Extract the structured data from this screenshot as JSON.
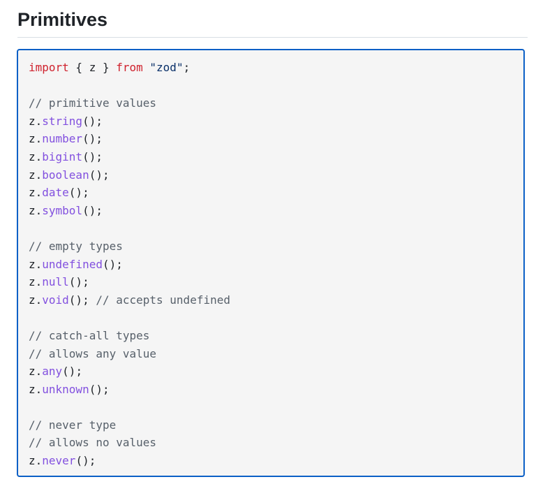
{
  "heading": "Primitives",
  "code_lines": [
    [
      {
        "t": "import",
        "c": "kw"
      },
      {
        "t": " { z } ",
        "c": "pl"
      },
      {
        "t": "from",
        "c": "kw"
      },
      {
        "t": " ",
        "c": "pl"
      },
      {
        "t": "\"zod\"",
        "c": "str"
      },
      {
        "t": ";",
        "c": "pl"
      }
    ],
    [],
    [
      {
        "t": "// primitive values",
        "c": "cm"
      }
    ],
    [
      {
        "t": "z.",
        "c": "pl"
      },
      {
        "t": "string",
        "c": "fn"
      },
      {
        "t": "();",
        "c": "pl"
      }
    ],
    [
      {
        "t": "z.",
        "c": "pl"
      },
      {
        "t": "number",
        "c": "fn"
      },
      {
        "t": "();",
        "c": "pl"
      }
    ],
    [
      {
        "t": "z.",
        "c": "pl"
      },
      {
        "t": "bigint",
        "c": "fn"
      },
      {
        "t": "();",
        "c": "pl"
      }
    ],
    [
      {
        "t": "z.",
        "c": "pl"
      },
      {
        "t": "boolean",
        "c": "fn"
      },
      {
        "t": "();",
        "c": "pl"
      }
    ],
    [
      {
        "t": "z.",
        "c": "pl"
      },
      {
        "t": "date",
        "c": "fn"
      },
      {
        "t": "();",
        "c": "pl"
      }
    ],
    [
      {
        "t": "z.",
        "c": "pl"
      },
      {
        "t": "symbol",
        "c": "fn"
      },
      {
        "t": "();",
        "c": "pl"
      }
    ],
    [],
    [
      {
        "t": "// empty types",
        "c": "cm"
      }
    ],
    [
      {
        "t": "z.",
        "c": "pl"
      },
      {
        "t": "undefined",
        "c": "fn"
      },
      {
        "t": "();",
        "c": "pl"
      }
    ],
    [
      {
        "t": "z.",
        "c": "pl"
      },
      {
        "t": "null",
        "c": "fn"
      },
      {
        "t": "();",
        "c": "pl"
      }
    ],
    [
      {
        "t": "z.",
        "c": "pl"
      },
      {
        "t": "void",
        "c": "fn"
      },
      {
        "t": "(); ",
        "c": "pl"
      },
      {
        "t": "// accepts undefined",
        "c": "cm"
      }
    ],
    [],
    [
      {
        "t": "// catch-all types",
        "c": "cm"
      }
    ],
    [
      {
        "t": "// allows any value",
        "c": "cm"
      }
    ],
    [
      {
        "t": "z.",
        "c": "pl"
      },
      {
        "t": "any",
        "c": "fn"
      },
      {
        "t": "();",
        "c": "pl"
      }
    ],
    [
      {
        "t": "z.",
        "c": "pl"
      },
      {
        "t": "unknown",
        "c": "fn"
      },
      {
        "t": "();",
        "c": "pl"
      }
    ],
    [],
    [
      {
        "t": "// never type",
        "c": "cm"
      }
    ],
    [
      {
        "t": "// allows no values",
        "c": "cm"
      }
    ],
    [
      {
        "t": "z.",
        "c": "pl"
      },
      {
        "t": "never",
        "c": "fn"
      },
      {
        "t": "();",
        "c": "pl"
      }
    ]
  ],
  "colors": {
    "keyword": "#cf222e",
    "string": "#0a3069",
    "function": "#8250df",
    "comment": "#57606a",
    "text": "#1f2328",
    "code_border": "#0b5fc6",
    "code_background": "#f5f5f5"
  }
}
